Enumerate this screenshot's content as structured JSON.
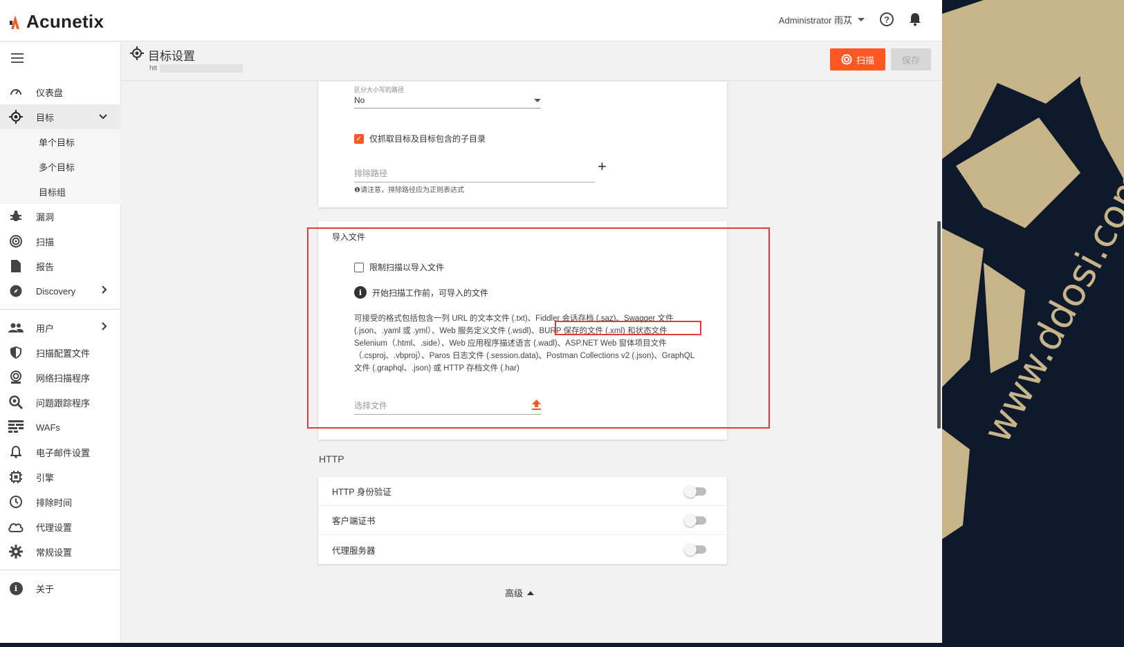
{
  "app": {
    "logo_text": "Acunetix",
    "brand_color": "#ff5722"
  },
  "topbar": {
    "user_label": "Administrator 雨苁",
    "help_glyph": "?"
  },
  "sidebar": {
    "items": [
      {
        "label": "仪表盘",
        "icon": "dashboard-icon"
      },
      {
        "label": "目标",
        "icon": "target-icon",
        "active": true,
        "expanded": true
      },
      {
        "label": "单个目标"
      },
      {
        "label": "多个目标"
      },
      {
        "label": "目标组"
      },
      {
        "label": "漏洞",
        "icon": "bug-icon"
      },
      {
        "label": "扫描",
        "icon": "scan-icon"
      },
      {
        "label": "报告",
        "icon": "report-icon"
      },
      {
        "label": "Discovery",
        "icon": "compass-icon"
      },
      {
        "label": "用户",
        "icon": "users-icon"
      },
      {
        "label": "扫描配置文件",
        "icon": "shield-icon"
      },
      {
        "label": "网络扫描程序",
        "icon": "network-scanner-icon"
      },
      {
        "label": "问题跟踪程序",
        "icon": "issue-tracker-icon"
      },
      {
        "label": "WAFs",
        "icon": "firewall-icon"
      },
      {
        "label": "电子邮件设置",
        "icon": "bell-icon"
      },
      {
        "label": "引擎",
        "icon": "chip-icon"
      },
      {
        "label": "排除时间",
        "icon": "clock-icon"
      },
      {
        "label": "代理设置",
        "icon": "cloud-icon"
      },
      {
        "label": "常规设置",
        "icon": "gear-icon"
      },
      {
        "label": "关于",
        "icon": "info-icon"
      }
    ]
  },
  "page": {
    "title": "目标设置",
    "subtitle_prefix": "htt",
    "scan_label": "扫描",
    "save_label": "保存"
  },
  "crawl": {
    "case_label": "区分大小写的路径",
    "case_value": "No",
    "only_subdirs_label": "仅抓取目标及目标包含的子目录",
    "exclude_placeholder": "排除路径",
    "exclude_hint": "❶请注意，排除路径应为正则表达式",
    "add_glyph": "+"
  },
  "import": {
    "section_label": "导入文件",
    "restrict_label": "限制扫描以导入文件",
    "info_text": "开始扫描工作前，可导入的文件",
    "desc_part1": "可接受的格式包括包含一列 URL 的文本文件 (.txt)、Fiddler 会话存档 (.saz)、Swagger 文件 (.json、.yaml 或 .yml）、Web 服务定义文件 (.wsdl)、",
    "desc_highlight": "BURP 保存的文件 (.xml) 和状态文件",
    "desc_part2": " Selenium（.html、.side）、Web 应用程序描述语言 (.wadl)、ASP.NET Web 窗体项目文件（.csproj、.vbproj）、Paros 日志文件 (.session.data)、Postman Collections v2 (.json)、GraphQL 文件 (.graphql、.json) 或 HTTP 存档文件 (.har)",
    "file_placeholder": "选择文件"
  },
  "http": {
    "section_title": "HTTP",
    "rows": [
      {
        "label": "HTTP 身份验证",
        "enabled": false
      },
      {
        "label": "客户端证书",
        "enabled": false
      },
      {
        "label": "代理服务器",
        "enabled": false
      }
    ]
  },
  "advanced_label": "高级",
  "watermark": "www.ddosi.com"
}
